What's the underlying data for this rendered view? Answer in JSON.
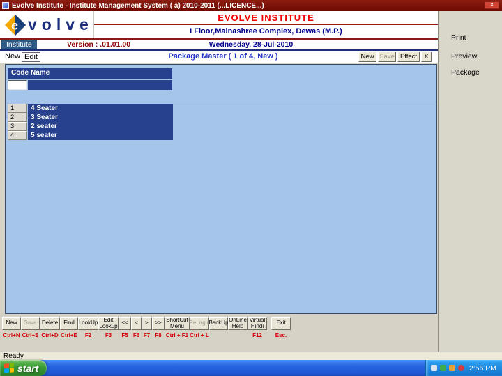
{
  "window": {
    "title": "Evolve Institute - Institute Management System ( a) 2010-2011 (...LICENCE...)"
  },
  "icons": {
    "close": "✕"
  },
  "header": {
    "logo_letter": "e",
    "logo_text": "volve",
    "institute_name": "EVOLVE INSTITUTE",
    "address": "I Floor,Mainashree Complex, Dewas (M.P.)",
    "date": "Wednesday, 28-Jul-2010",
    "module": "Institute",
    "version": "Version : .01.01.00"
  },
  "menubar": {
    "items": [
      {
        "label": "New"
      },
      {
        "label": "Edit"
      }
    ],
    "form_title": "Package Master  ( 1 of 4, New )",
    "buttons": [
      {
        "label": "New",
        "enabled": true
      },
      {
        "label": "Save",
        "enabled": false
      },
      {
        "label": "Effect",
        "enabled": true
      },
      {
        "label": "X",
        "enabled": true
      }
    ]
  },
  "grid": {
    "columns": [
      "Code",
      "Name"
    ],
    "input_row": {
      "code": "",
      "name": ""
    },
    "rows": [
      {
        "code": "1",
        "name": "4 Seater"
      },
      {
        "code": "2",
        "name": "3 Seater"
      },
      {
        "code": "3",
        "name": "2 seater"
      },
      {
        "code": "4",
        "name": "5 seater"
      }
    ]
  },
  "sidebar": {
    "buttons": [
      {
        "label": "Print"
      },
      {
        "label": "Preview"
      },
      {
        "label": "Package"
      }
    ]
  },
  "toolbar": {
    "buttons": [
      {
        "label": "New",
        "shortcut": "Ctrl+N",
        "enabled": true
      },
      {
        "label": "Save",
        "shortcut": "Ctrl+S",
        "enabled": false
      },
      {
        "label": "Delete",
        "shortcut": "Ctrl+D",
        "enabled": true
      },
      {
        "label": "Find",
        "shortcut": "Ctrl+E",
        "enabled": true
      },
      {
        "label": "LookUp",
        "shortcut": "F2",
        "enabled": true
      },
      {
        "label": "Edit Lookup",
        "shortcut": "F3",
        "enabled": true
      },
      {
        "label": "<<",
        "shortcut": "F5",
        "enabled": true
      },
      {
        "label": "<",
        "shortcut": "F6",
        "enabled": true
      },
      {
        "label": ">",
        "shortcut": "F7",
        "enabled": true
      },
      {
        "label": ">>",
        "shortcut": "F8",
        "enabled": true
      },
      {
        "label": "ShortCut Menu",
        "shortcut": "Ctrl + F1",
        "enabled": true
      },
      {
        "label": "ReLogin",
        "shortcut": "Ctrl + L",
        "enabled": false
      },
      {
        "label": "BackUp",
        "shortcut": "",
        "enabled": true
      },
      {
        "label": "OnLine Help",
        "shortcut": "",
        "enabled": true
      },
      {
        "label": "Virtual Hindi",
        "shortcut": "F12",
        "enabled": true
      },
      {
        "label": "Exit",
        "shortcut": "Esc.",
        "enabled": true
      }
    ]
  },
  "statusbar": {
    "text": "Ready"
  },
  "taskbar": {
    "start_label": "start",
    "time": "2:56 PM"
  },
  "colors": {
    "titlebar": "#7b0e04",
    "brand_red": "#f20000",
    "navy": "#00008b",
    "grid_blue": "#27418e",
    "content_bg": "#a5c6ea",
    "shortcut_red": "#d40000",
    "taskbar_blue": "#2159d6",
    "start_green": "#379a33"
  }
}
